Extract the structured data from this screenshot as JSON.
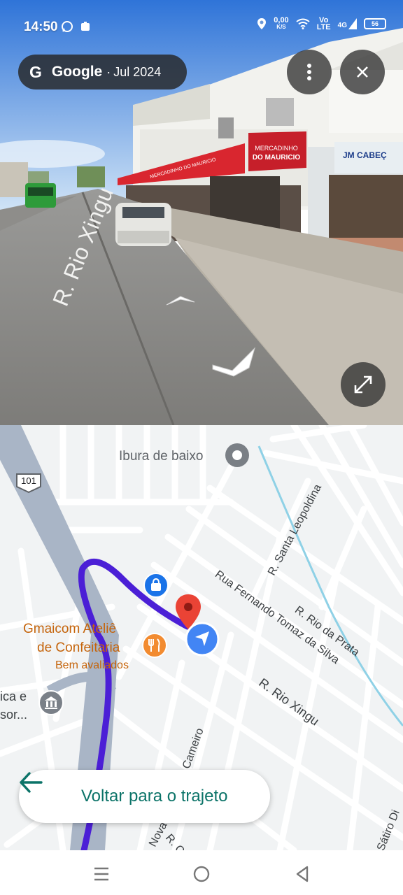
{
  "status_bar": {
    "time": "14:50",
    "net_speed_top": "0,00",
    "net_speed_bottom": "K/S",
    "volte_top": "Vo",
    "volte_bottom": "LTE",
    "network": "4G",
    "battery": "56"
  },
  "street_view": {
    "brand": "Google",
    "separator": "·",
    "capture_date": "Jul 2024",
    "road_marking": "R. Rio Xingu",
    "sign_left": "MERCADINHO DO MAURICIO",
    "sign_right_top": "MERCADINHO",
    "sign_right_bottom": "DO MAURICIO",
    "sign_shop": "JM CABEÇ"
  },
  "map": {
    "route_number": "101",
    "place_ibura": "Ibura de baixo",
    "place_gmaicom_line1": "Gmaicom Ateliê",
    "place_gmaicom_line2": "de Confeitaria",
    "place_gmaicom_sub": "Bem avaliados",
    "place_partial_line1": "ica e",
    "place_partial_line2": "sor...",
    "streets": {
      "santa_leopoldina": "R. Santa Leopoldina",
      "fernando": "Rua Fernando Tomaz da Silva",
      "rio_da_prata": "R. Rio da Prata",
      "rio_xingu": "R. Rio Xingu",
      "cameiro": "Cameiro",
      "nova": "Nova",
      "r_ca": "R. Ca",
      "satiro": "Sátiro Di"
    },
    "back_button_label": "Voltar para o trajeto",
    "colors": {
      "route": "#4b1fd6",
      "pin": "#ea4335",
      "location": "#4285f4",
      "back_label": "#0b7368",
      "restaurant": "#f28b30"
    }
  },
  "icons": {
    "whatsapp": "whatsapp-icon",
    "notification": "notification-icon",
    "location": "location-icon",
    "wifi": "wifi-icon",
    "signal": "signal-icon",
    "battery": "battery-icon",
    "more": "more-vert-icon",
    "close": "close-icon",
    "expand": "expand-icon",
    "nav_arrow_up": "chevron-up-icon",
    "nav_arrow_down": "chevron-down-icon",
    "back_arrow": "arrow-left-icon",
    "menu": "menu-icon",
    "home": "home-icon",
    "back": "back-icon"
  }
}
